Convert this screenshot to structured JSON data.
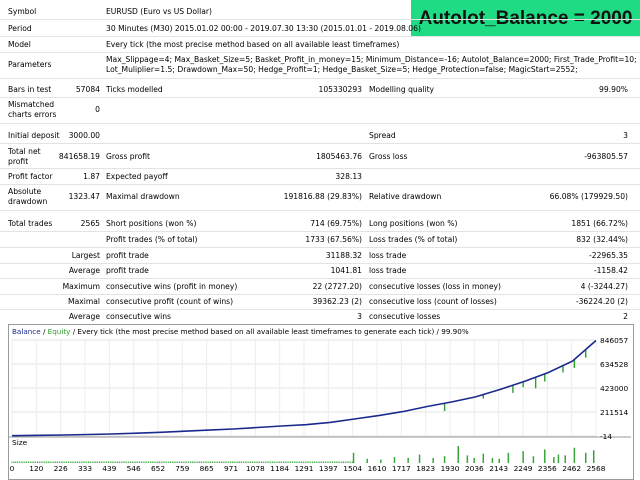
{
  "badge": "Autolot_Balance = 2000",
  "header": {
    "symbol_label": "Symbol",
    "symbol_value": "EURUSD (Euro vs US Dollar)",
    "period_label": "Period",
    "period_value": "30 Minutes (M30) 2015.01.02 00:00 - 2019.07.30 13:30 (2015.01.01 - 2019.08.06)",
    "model_label": "Model",
    "model_value": "Every tick (the most precise method based on all available least timeframes)",
    "params_label": "Parameters",
    "params_line1": "Max_Slippage=4; Max_Basket_Size=5; Basket_Profit_in_money=15; Minimum_Distance=-16; Autolot_Balance=2000; First_Trade_Profit=10;",
    "params_line2": "Lot_Muliplier=1.5; Drawdown_Max=50; Hedge_Profit=1; Hedge_Basket_Size=5; Hedge_Protection=false; MagicStart=2552;"
  },
  "stats": {
    "bars_label": "Bars in test",
    "bars_value": "57084",
    "ticks_label": "Ticks modelled",
    "ticks_value": "105330293",
    "quality_label": "Modelling quality",
    "quality_value": "99.90%",
    "mismatch_label1": "Mismatched",
    "mismatch_label2": "charts errors",
    "mismatch_value": "0",
    "deposit_label": "Initial deposit",
    "deposit_value": "3000.00",
    "spread_label": "Spread",
    "spread_value": "3",
    "netprofit_label1": "Total net",
    "netprofit_label2": "profit",
    "netprofit_value": "841658.19",
    "grossprofit_label": "Gross profit",
    "grossprofit_value": "1805463.76",
    "grossloss_label": "Gross loss",
    "grossloss_value": "-963805.57",
    "pf_label": "Profit factor",
    "pf_value": "1.87",
    "payoff_label": "Expected payoff",
    "payoff_value": "328.13",
    "absdd_label1": "Absolute",
    "absdd_label2": "drawdown",
    "absdd_value": "1323.47",
    "maxdd_label": "Maximal drawdown",
    "maxdd_value": "191816.88 (29.83%)",
    "reldd_label": "Relative drawdown",
    "reldd_value": "66.08% (179929.50)",
    "trades_label": "Total trades",
    "trades_value": "2565",
    "short_label": "Short positions (won %)",
    "short_value": "714 (69.75%)",
    "long_label": "Long positions (won %)",
    "long_value": "1851 (66.72%)",
    "ptrades_label": "Profit trades (% of total)",
    "ptrades_value": "1733 (67.56%)",
    "ltrades_label": "Loss trades (% of total)",
    "ltrades_value": "832 (32.44%)",
    "largest_label": "Largest",
    "largest_profit_label": "profit trade",
    "largest_profit_value": "31188.32",
    "largest_loss_label": "loss trade",
    "largest_loss_value": "-22965.35",
    "average_label": "Average",
    "average_profit_label": "profit trade",
    "average_profit_value": "1041.81",
    "average_loss_label": "loss trade",
    "average_loss_value": "-1158.42",
    "maximum_label": "Maximum",
    "cwins_money_label": "consecutive wins (profit in money)",
    "cwins_money_value": "22 (2727.20)",
    "closs_money_label": "consecutive losses (loss in money)",
    "closs_money_value": "4 (-3244.27)",
    "maximal_label": "Maximal",
    "cprofit_count_label": "consecutive profit (count of wins)",
    "cprofit_count_value": "39362.23 (2)",
    "closs_count_label": "consecutive loss (count of losses)",
    "closs_count_value": "-36224.20 (2)",
    "average2_label": "Average",
    "awins_label": "consecutive wins",
    "awins_value": "3",
    "alosses_label": "consecutive losses",
    "alosses_value": "2"
  },
  "chart_header": {
    "balance": "Balance",
    "slash1": " / ",
    "equity": "Equity",
    "rest": " / Every tick (the most precise method based on all available least timeframes to generate each tick) / 99.90%"
  },
  "colors": {
    "balance": "#1a2a8c",
    "equity": "#2e9e2e",
    "size_bars": "#3aa53a",
    "badge": "#1fdc84"
  },
  "chart_data": {
    "type": "line",
    "y_ticks": [
      "846057",
      "634528",
      "423000",
      "211514",
      "-14"
    ],
    "x_ticks": [
      "0",
      "120",
      "226",
      "333",
      "439",
      "546",
      "652",
      "759",
      "865",
      "971",
      "1078",
      "1184",
      "1291",
      "1397",
      "1504",
      "1610",
      "1717",
      "1823",
      "1930",
      "2036",
      "2143",
      "2249",
      "2356",
      "2462",
      "2568"
    ],
    "size_label": "Size",
    "series": [
      {
        "name": "Balance",
        "x": [
          0,
          120,
          226,
          333,
          439,
          546,
          652,
          759,
          865,
          971,
          1078,
          1184,
          1291,
          1397,
          1504,
          1610,
          1717,
          1823,
          1930,
          2036,
          2143,
          2249,
          2356,
          2462,
          2565
        ],
        "values": [
          3000,
          6000,
          9000,
          13000,
          18000,
          25000,
          33000,
          42000,
          52000,
          62000,
          75000,
          88000,
          100000,
          120000,
          150000,
          180000,
          215000,
          260000,
          300000,
          345000,
          410000,
          480000,
          560000,
          660000,
          841658
        ]
      },
      {
        "name": "Equity",
        "x": [
          1900,
          1960,
          2070,
          2200,
          2245,
          2300,
          2340,
          2420,
          2470,
          2520
        ],
        "values": [
          220000,
          310000,
          330000,
          380000,
          430000,
          420000,
          480000,
          560000,
          600000,
          690000
        ]
      }
    ],
    "ylim": [
      -14,
      846057
    ],
    "xlim": [
      0,
      2565
    ]
  }
}
